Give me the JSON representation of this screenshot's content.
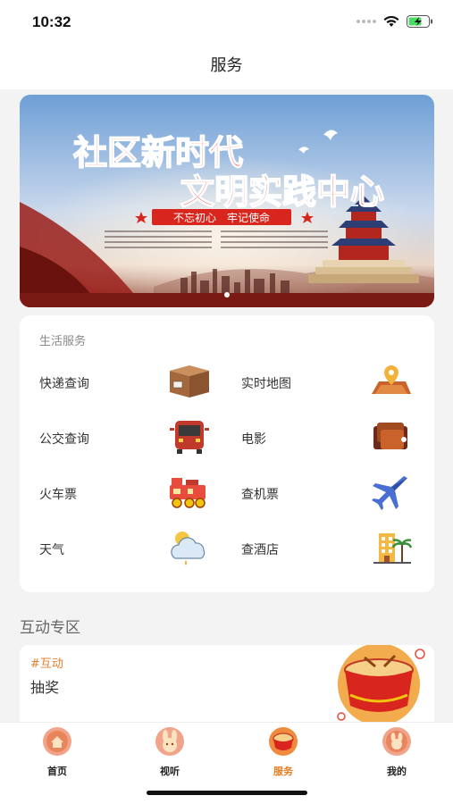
{
  "status": {
    "time": "10:32"
  },
  "header": {
    "title": "服务"
  },
  "banner": {
    "line1": "社区新时代",
    "line2": "文明实践中心",
    "slogan": "不忘初心　牢记使命"
  },
  "life_services": {
    "title": "生活服务",
    "items": [
      {
        "label": "快递查询",
        "icon": "package-icon"
      },
      {
        "label": "实时地图",
        "icon": "map-pin-icon"
      },
      {
        "label": "公交查询",
        "icon": "bus-icon"
      },
      {
        "label": "电影",
        "icon": "film-ticket-icon"
      },
      {
        "label": "火车票",
        "icon": "train-icon"
      },
      {
        "label": "查机票",
        "icon": "airplane-icon"
      },
      {
        "label": "天气",
        "icon": "weather-icon"
      },
      {
        "label": "查酒店",
        "icon": "hotel-icon"
      }
    ]
  },
  "interactive": {
    "title": "互动专区",
    "card": {
      "tag": "#互动",
      "name": "抽奖"
    }
  },
  "tabbar": {
    "tabs": [
      {
        "label": "首页",
        "active": false
      },
      {
        "label": "视听",
        "active": false
      },
      {
        "label": "服务",
        "active": true
      },
      {
        "label": "我的",
        "active": false
      }
    ]
  },
  "colors": {
    "accent": "#e67b1f",
    "banner_red": "#d8261f"
  }
}
